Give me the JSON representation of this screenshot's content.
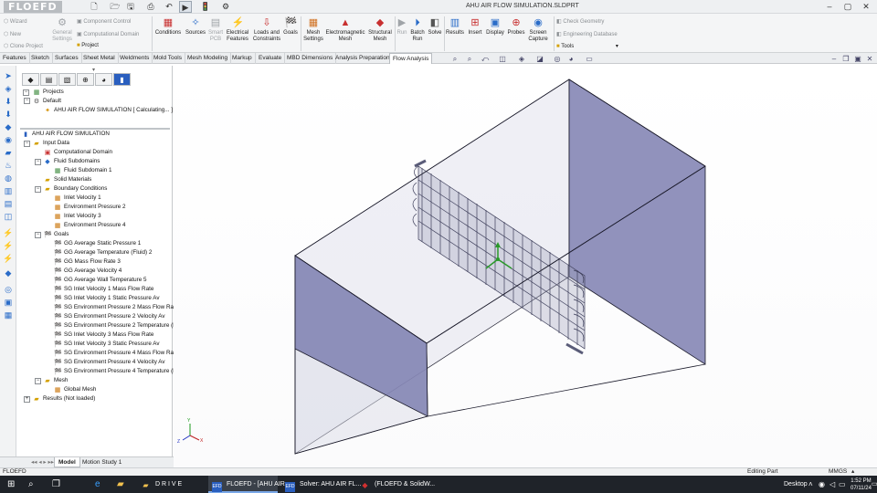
{
  "app": {
    "name": "FLOEFD",
    "title": "AHU AIR FLOW SIMULATION.SLDPRT"
  },
  "quick_access": [
    "new-icon",
    "open-icon",
    "save-icon",
    "print-icon",
    "undo-icon",
    "select-icon",
    "rebuild-icon",
    "options-icon"
  ],
  "ribbon": {
    "left_small": {
      "wizard": "Wizard",
      "new": "New",
      "clone": "Clone Project",
      "general": "General Settings",
      "component": "Component Control",
      "comp_domain": "Computational Domain",
      "project": "Project"
    },
    "buttons": [
      "Conditions",
      "Sources",
      "Smart PCB",
      "Electrical Features",
      "Loads and Constraints",
      "Goals",
      "Mesh Settings",
      "Electromagnetic Mesh",
      "Structural Mesh",
      "Run",
      "Batch Run",
      "Solve",
      "Results",
      "Insert",
      "Display",
      "Probes",
      "Screen Capture"
    ],
    "right_small": {
      "check": "Check Geometry",
      "engdb": "Engineering Database",
      "tools": "Tools"
    }
  },
  "tabs": [
    "Features",
    "Sketch",
    "Surfaces",
    "Sheet Metal",
    "Weldments",
    "Mold Tools",
    "Mesh Modeling",
    "Markup",
    "Evaluate",
    "MBD Dimensions",
    "Analysis Preparation",
    "Flow Analysis"
  ],
  "active_tab": "Flow Analysis",
  "panel": {
    "projects": {
      "root": "Projects",
      "default": "Default",
      "item": "AHU AIR FLOW SIMULATION [ Calculating... ]"
    },
    "analysis": {
      "root": "AHU AIR FLOW SIMULATION",
      "input_data": "Input Data",
      "comp_domain": "Computational Domain",
      "fluid_subdomains": "Fluid Subdomains",
      "fluid_subdomain_1": "Fluid Subdomain 1",
      "solid_materials": "Solid Materials",
      "boundary_conditions": "Boundary Conditions",
      "bc": [
        "Inlet Velocity 1",
        "Environment Pressure 2",
        "Inlet Velocity 3",
        "Environment Pressure 4"
      ],
      "goals_label": "Goals",
      "goals": [
        "GG Average Static Pressure 1",
        "GG Average Temperature (Fluid) 2",
        "GG Mass Flow Rate 3",
        "GG Average Velocity 4",
        "GG Average Wall Temperature 5",
        "SG Inlet Velocity 1 Mass Flow Rate",
        "SG Inlet Velocity 1 Static Pressure Av",
        "SG Environment Pressure 2 Mass Flow Rate",
        "SG Environment Pressure 2 Velocity Av",
        "SG Environment Pressure 2 Temperature (Flu",
        "SG Inlet Velocity 3 Mass Flow Rate",
        "SG Inlet Velocity 3 Static Pressure Av",
        "SG Environment Pressure 4 Mass Flow Rate",
        "SG Environment Pressure 4 Velocity Av",
        "SG Environment Pressure 4 Temperature (Flu"
      ],
      "mesh": "Mesh",
      "global_mesh": "Global Mesh",
      "results": "Results (Not loaded)"
    }
  },
  "bottom_tabs": [
    "Model",
    "Motion Study 1"
  ],
  "active_bottom_tab": "Model",
  "status": {
    "left": "FLOEFD",
    "mode": "Editing Part",
    "units": "MMGS"
  },
  "taskbar": {
    "items": [
      {
        "label": "D R I V E",
        "icon": "folder-icon"
      },
      {
        "label": "FLOEFD - [AHU AIR...",
        "icon": "floefd-icon"
      },
      {
        "label": "Solver: AHU AIR FL...",
        "icon": "solver-icon"
      },
      {
        "label": "(FLOEFD & SolidW...",
        "icon": "solidworks-icon"
      }
    ],
    "desktop": "Desktop",
    "time": "1:52 PM",
    "date": "07/11/24"
  }
}
